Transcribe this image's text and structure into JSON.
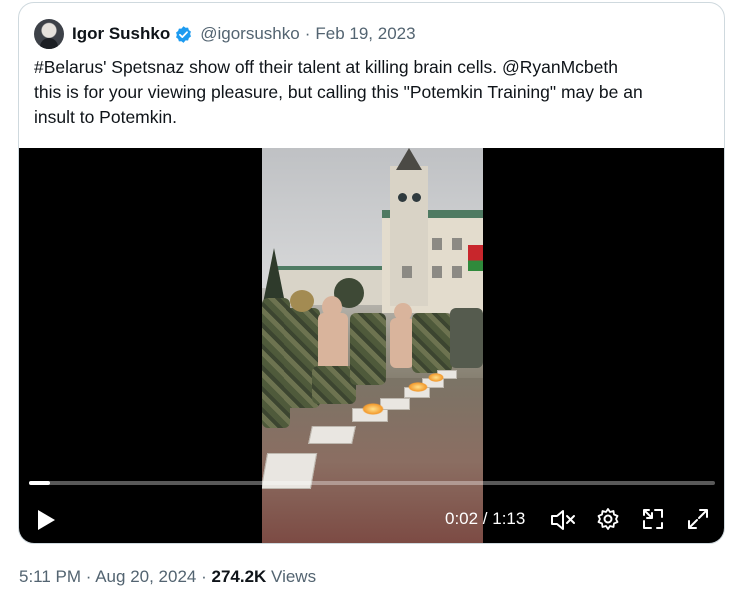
{
  "tweet": {
    "author_name": "Igor Sushko",
    "handle": "@igorsushko",
    "separator": "·",
    "date": "Feb 19, 2023",
    "text": "#Belarus' Spetsnaz show off their talent at killing brain cells. @RyanMcbeth\nthis is for your viewing pleasure, but calling this \"Potemkin Training\" may be an\ninsult to Potemkin."
  },
  "video": {
    "time_display": "0:02 / 1:13",
    "progress_fraction": 0.03,
    "icons": [
      "play-icon",
      "volume-muted-icon",
      "settings-gear-icon",
      "minimize-icon",
      "fullscreen-icon"
    ]
  },
  "footer": {
    "timestamp": "5:11 PM · Aug 20, 2024 · ",
    "views_count": "274.2K",
    "views_label": " Views"
  },
  "colors": {
    "verified_blue": "#1d9bf0",
    "secondary_text": "#536471",
    "primary_text": "#0f1419",
    "border": "#cfd9de"
  }
}
